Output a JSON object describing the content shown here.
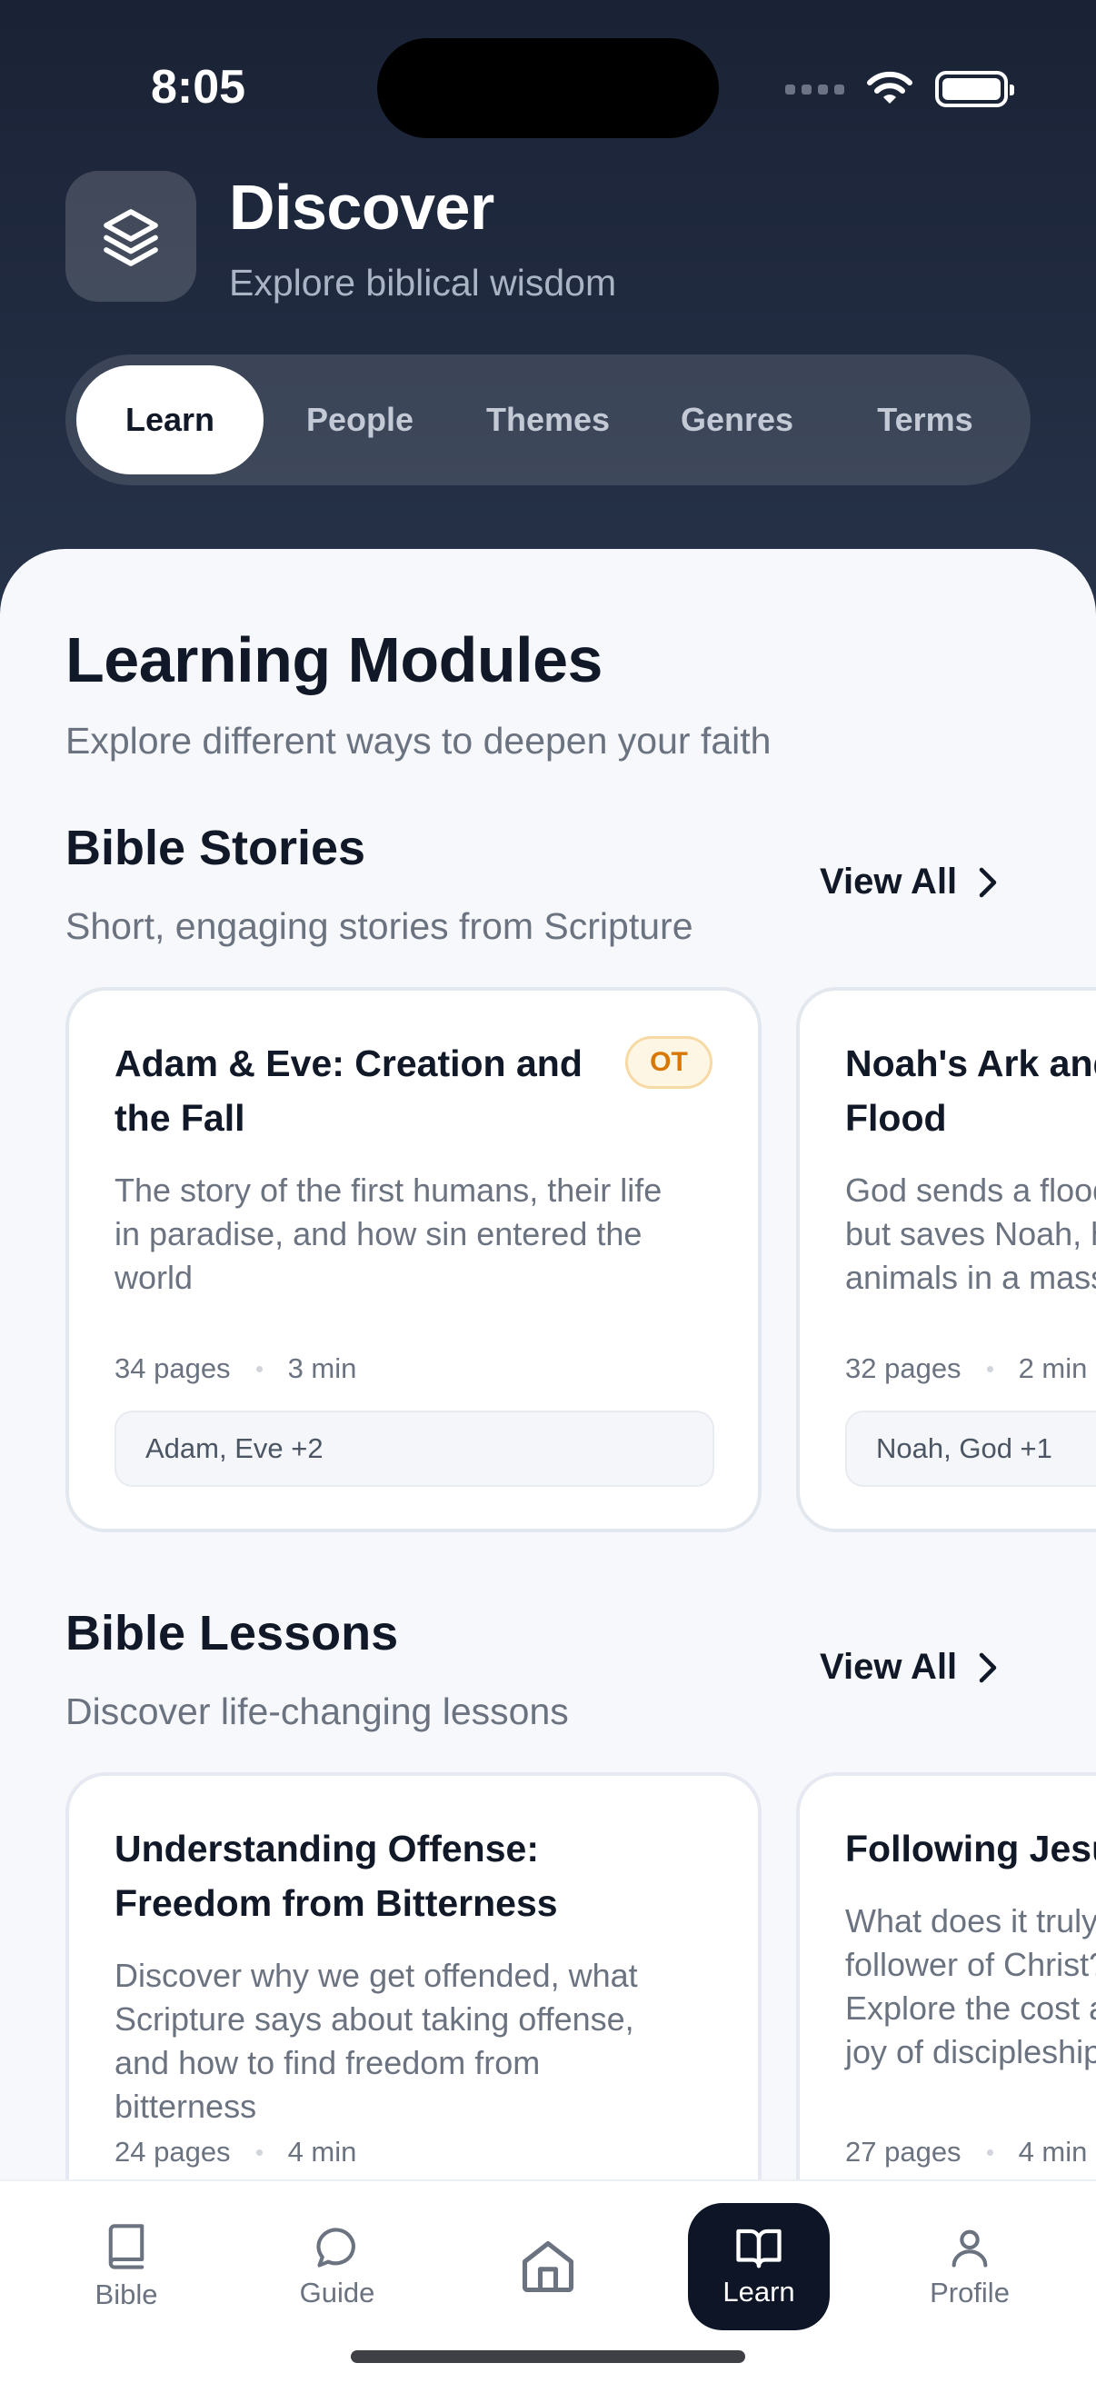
{
  "status_bar": {
    "time": "8:05"
  },
  "header": {
    "title": "Discover",
    "subtitle": "Explore biblical wisdom",
    "logo_icon": "layers-icon"
  },
  "tabs": [
    {
      "label": "Learn",
      "active": true
    },
    {
      "label": "People",
      "active": false
    },
    {
      "label": "Themes",
      "active": false
    },
    {
      "label": "Genres",
      "active": false
    },
    {
      "label": "Terms",
      "active": false
    }
  ],
  "main": {
    "title": "Learning Modules",
    "subtitle": "Explore different ways to deepen your faith",
    "sections": [
      {
        "title": "Bible Stories",
        "subtitle": "Short, engaging stories from Scripture",
        "view_all": "View All",
        "cards": [
          {
            "title_line1": "Adam & Eve: Creation and",
            "title_line2": "the Fall",
            "badge": "OT",
            "desc_line1": "The story of the first humans, their life",
            "desc_line2": "in paradise, and how sin entered the",
            "desc_line3": "world",
            "pages": "34 pages",
            "duration": "3 min",
            "characters": "Adam, Eve +2"
          },
          {
            "title_line1": "Noah's Ark and the",
            "title_line2": "Flood",
            "desc_line1": "God sends a flood to cleanse the earth",
            "desc_line2": "but saves Noah, his family, and the",
            "desc_line3": "animals in a massive ark",
            "pages": "32 pages",
            "duration": "2 min",
            "characters": "Noah, God +1"
          }
        ]
      },
      {
        "title": "Bible Lessons",
        "subtitle": "Discover life-changing lessons",
        "view_all": "View All",
        "cards": [
          {
            "title_line1": "Understanding Offense:",
            "title_line2": "Freedom from Bitterness",
            "desc_line1": "Discover why we get offended, what",
            "desc_line2": "Scripture says about taking offense,",
            "desc_line3": "and how to find freedom from",
            "desc_line4": "bitterness",
            "pages": "24 pages",
            "duration": "4 min"
          },
          {
            "title_line1": "Following Jesus",
            "desc_line1": "What does it truly mean to be a",
            "desc_line2": "follower of Christ?",
            "desc_line3": "Explore the cost and",
            "desc_line4": "joy of discipleship",
            "pages": "27 pages",
            "duration": "4 min"
          }
        ]
      }
    ]
  },
  "bottom_nav": [
    {
      "label": "Bible",
      "icon": "book-icon",
      "active": false
    },
    {
      "label": "Guide",
      "icon": "chat-bubble-icon",
      "active": false
    },
    {
      "label": "",
      "icon": "home-icon",
      "active": false
    },
    {
      "label": "Learn",
      "icon": "open-book-icon",
      "active": true
    },
    {
      "label": "Profile",
      "icon": "person-icon",
      "active": false
    }
  ],
  "colors": {
    "header_bg": "#1a2235",
    "accent_dark": "#0d1526",
    "badge_text": "#d97706"
  }
}
